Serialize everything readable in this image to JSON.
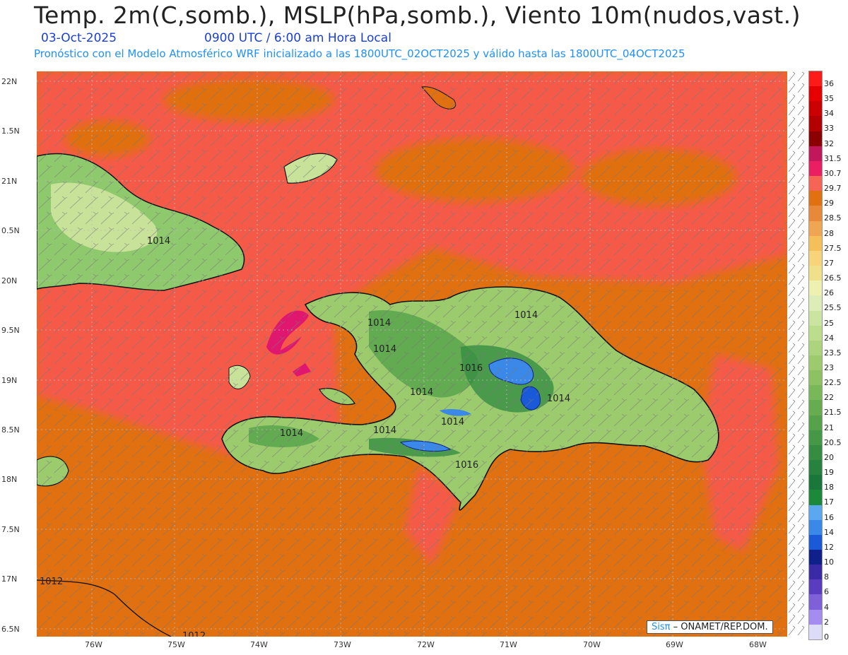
{
  "header": {
    "title": "Temp. 2m(C,somb.), MSLP(hPa,somb.), Viento 10m(nudos,vast.)",
    "date": "03-Oct-2025",
    "time": "0900 UTC / 6:00 am Hora Local",
    "description": "Pronóstico con el Modelo Atmosférico WRF inicializado a las 1800UTC_02OCT2025 y válido hasta las  1800UTC_04OCT2025"
  },
  "map": {
    "lat_labels": [
      "22N",
      "1.5N",
      "21N",
      "0.5N",
      "20N",
      "9.5N",
      "19N",
      "8.5N",
      "18N",
      "7.5N",
      "17N",
      "6.5N"
    ],
    "lon_labels": [
      "76W",
      "75W",
      "74W",
      "73W",
      "72W",
      "71W",
      "70W",
      "69W",
      "68W"
    ],
    "isobar_labels": [
      "1014",
      "1014",
      "1014",
      "1014",
      "1016",
      "1014",
      "1014",
      "1014",
      "1014",
      "1016",
      "1014",
      "1012",
      "1012"
    ],
    "colors": {
      "ocean_warm": "#e07010",
      "ocean_hot": "#f55a4a",
      "max_hot": "#e0176e",
      "land_green": "#8fc96e",
      "land_light": "#c8e29a",
      "land_dark": "#3e9a4c",
      "mountain": "#2e6ae0"
    }
  },
  "colorbar": {
    "labels": [
      "36",
      "35",
      "34",
      "33",
      "32",
      "31.5",
      "30.7",
      "29.7",
      "29",
      "28.5",
      "28",
      "27.5",
      "27",
      "26.5",
      "26",
      "25.5",
      "25",
      "24",
      "23.5",
      "23",
      "22.5",
      "22",
      "21.5",
      "21",
      "20.5",
      "20",
      "19",
      "18",
      "17",
      "16",
      "14",
      "12",
      "10",
      "8",
      "6",
      "4",
      "2",
      "0"
    ],
    "colors": [
      "#ff1a1a",
      "#e60000",
      "#cc0000",
      "#b30000",
      "#8b0000",
      "#c2185b",
      "#e91e63",
      "#f56454",
      "#e07010",
      "#e8893a",
      "#efa552",
      "#f5c05a",
      "#f7d37a",
      "#f0e08a",
      "#eef0b0",
      "#dcedb8",
      "#cbe4a0",
      "#bcdd8c",
      "#acd47c",
      "#9ccb6e",
      "#8cc262",
      "#78b858",
      "#66ad50",
      "#55a24a",
      "#459846",
      "#368d42",
      "#27823e",
      "#1a773a",
      "#1a8a3a",
      "#5aa8f0",
      "#3a88e8",
      "#1a5ad8",
      "#10208a",
      "#3a2aa8",
      "#5a3cc0",
      "#8060d8",
      "#a58cf0",
      "#dcdcf8"
    ]
  },
  "credit": {
    "brand": "Sisπ",
    "text": "– ONAMET/REP.DOM."
  }
}
